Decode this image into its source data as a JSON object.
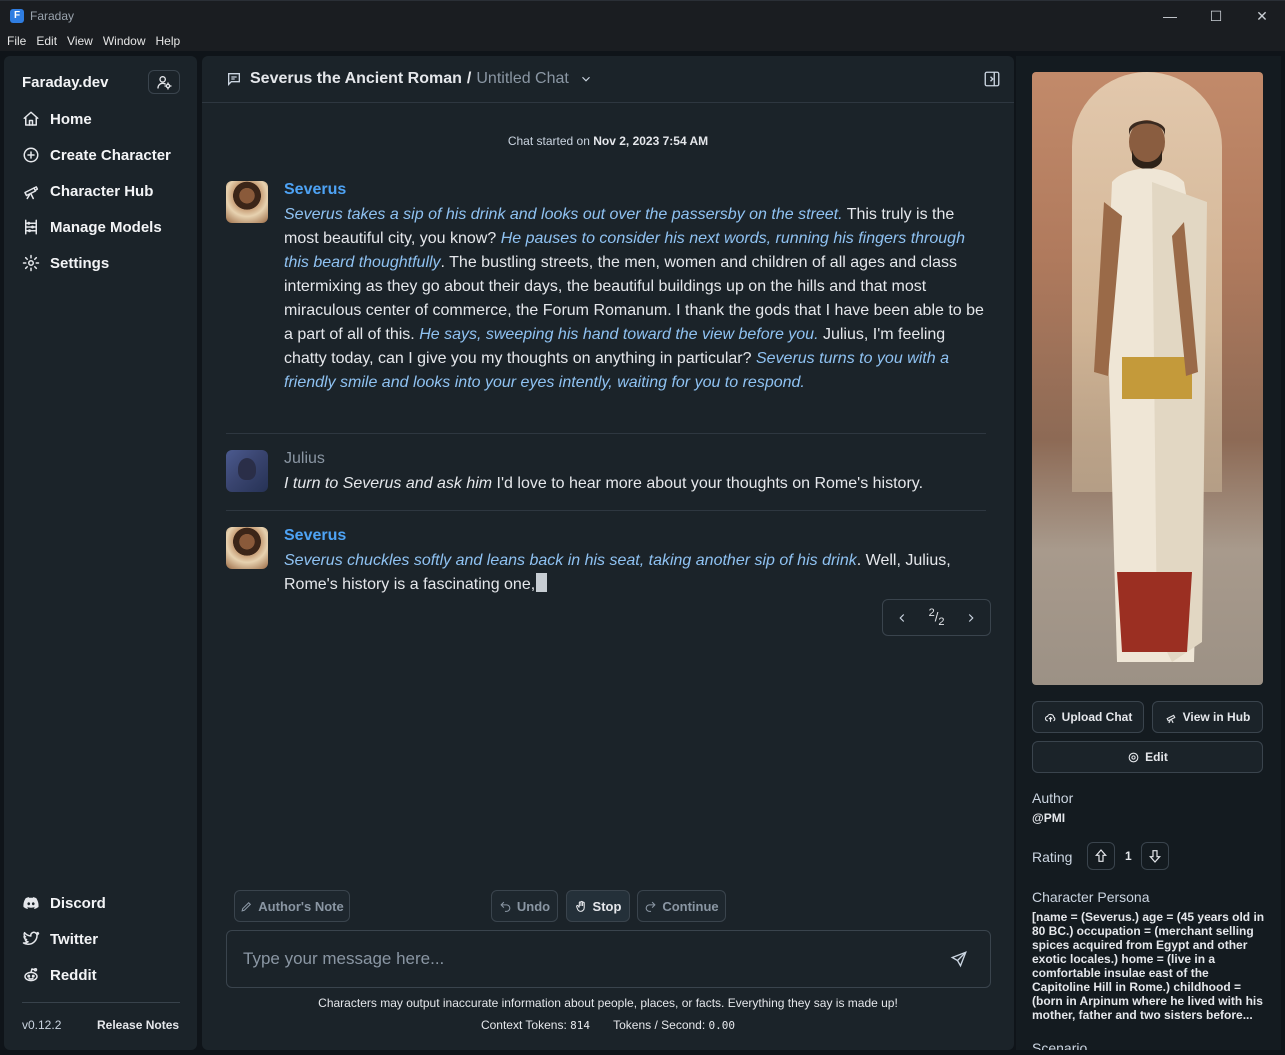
{
  "window": {
    "title": "Faraday"
  },
  "menu": [
    "File",
    "Edit",
    "View",
    "Window",
    "Help"
  ],
  "sidebar": {
    "brand": "Faraday.dev",
    "nav": [
      {
        "label": "Home",
        "icon": "home-icon"
      },
      {
        "label": "Create Character",
        "icon": "plus-circle-icon"
      },
      {
        "label": "Character Hub",
        "icon": "telescope-icon"
      },
      {
        "label": "Manage Models",
        "icon": "abacus-icon"
      },
      {
        "label": "Settings",
        "icon": "gear-icon"
      }
    ],
    "social": [
      {
        "label": "Discord",
        "icon": "discord-icon"
      },
      {
        "label": "Twitter",
        "icon": "twitter-icon"
      },
      {
        "label": "Reddit",
        "icon": "reddit-icon"
      }
    ],
    "version": "v0.12.2",
    "release_notes": "Release Notes"
  },
  "chat": {
    "character": "Severus the Ancient Roman",
    "separator": "/",
    "title": "Untitled Chat",
    "started_prefix": "Chat started on",
    "started_date": "Nov 2, 2023 7:54 AM",
    "messages": [
      {
        "author": "Severus",
        "role": "character",
        "segments": [
          {
            "t": "Severus takes a sip of his drink and looks out over the passersby on the street.",
            "i": true
          },
          {
            "t": " This truly is the most beautiful city, you know? ",
            "i": false
          },
          {
            "t": "He pauses to consider his next words, running his fingers through this beard thoughtfully",
            "i": true
          },
          {
            "t": ". The bustling streets, the men, women and children of all ages and class intermixing as they go about their days, the beautiful buildings up on the hills and that most miraculous center of commerce, the Forum Romanum. I thank the gods that I have been able to be a part of all of this. ",
            "i": false
          },
          {
            "t": "He says, sweeping his hand toward the view before you.",
            "i": true
          },
          {
            "t": " Julius, I'm feeling chatty today, can I give you my thoughts on anything in particular? ",
            "i": false
          },
          {
            "t": "Severus turns to you with a friendly smile and looks into your eyes intently, waiting for you to respond.",
            "i": true
          }
        ]
      },
      {
        "author": "Julius",
        "role": "user",
        "segments": [
          {
            "t": "I turn to Severus and ask him",
            "i": true
          },
          {
            "t": " I'd love to hear more about your thoughts on Rome's history.",
            "i": false
          }
        ]
      },
      {
        "author": "Severus",
        "role": "character",
        "segments": [
          {
            "t": "Severus chuckles softly and leans back in his seat, taking another sip of his drink",
            "i": true
          },
          {
            "t": ". Well, Julius, Rome's history is a fascinating one,",
            "i": false
          }
        ]
      }
    ],
    "swipe": {
      "current": "2",
      "total": "2"
    },
    "buttons": {
      "authors_note": "Author's Note",
      "undo": "Undo",
      "stop": "Stop",
      "continue": "Continue"
    },
    "input": {
      "placeholder": "Type your message here...",
      "value": ""
    },
    "disclaimer": "Characters may output inaccurate information about people, places, or facts. Everything they say is made up!",
    "context_tokens_label": "Context Tokens:",
    "context_tokens": "814",
    "tps_label": "Tokens / Second:",
    "tps": "0.00"
  },
  "character_panel": {
    "upload_chat": "Upload Chat",
    "view_in_hub": "View in Hub",
    "edit": "Edit",
    "author_label": "Author",
    "author": "@PMI",
    "rating_label": "Rating",
    "rating": "1",
    "persona_label": "Character Persona",
    "persona": "[name = (Severus.) age = (45 years old in 80 BC.) occupation = (merchant selling spices acquired from Egypt and other exotic locales.) home = (live in a comfortable insulae east of the Capitoline Hill in Rome.) childhood = (born in Arpinum where he lived with his mother, father and two sisters before...",
    "scenario_label": "Scenario"
  },
  "colors": {
    "accent": "#4ea3f5",
    "panel": "#1b2329",
    "background": "#0f1419",
    "italic_narration": "#8fc2f2"
  }
}
